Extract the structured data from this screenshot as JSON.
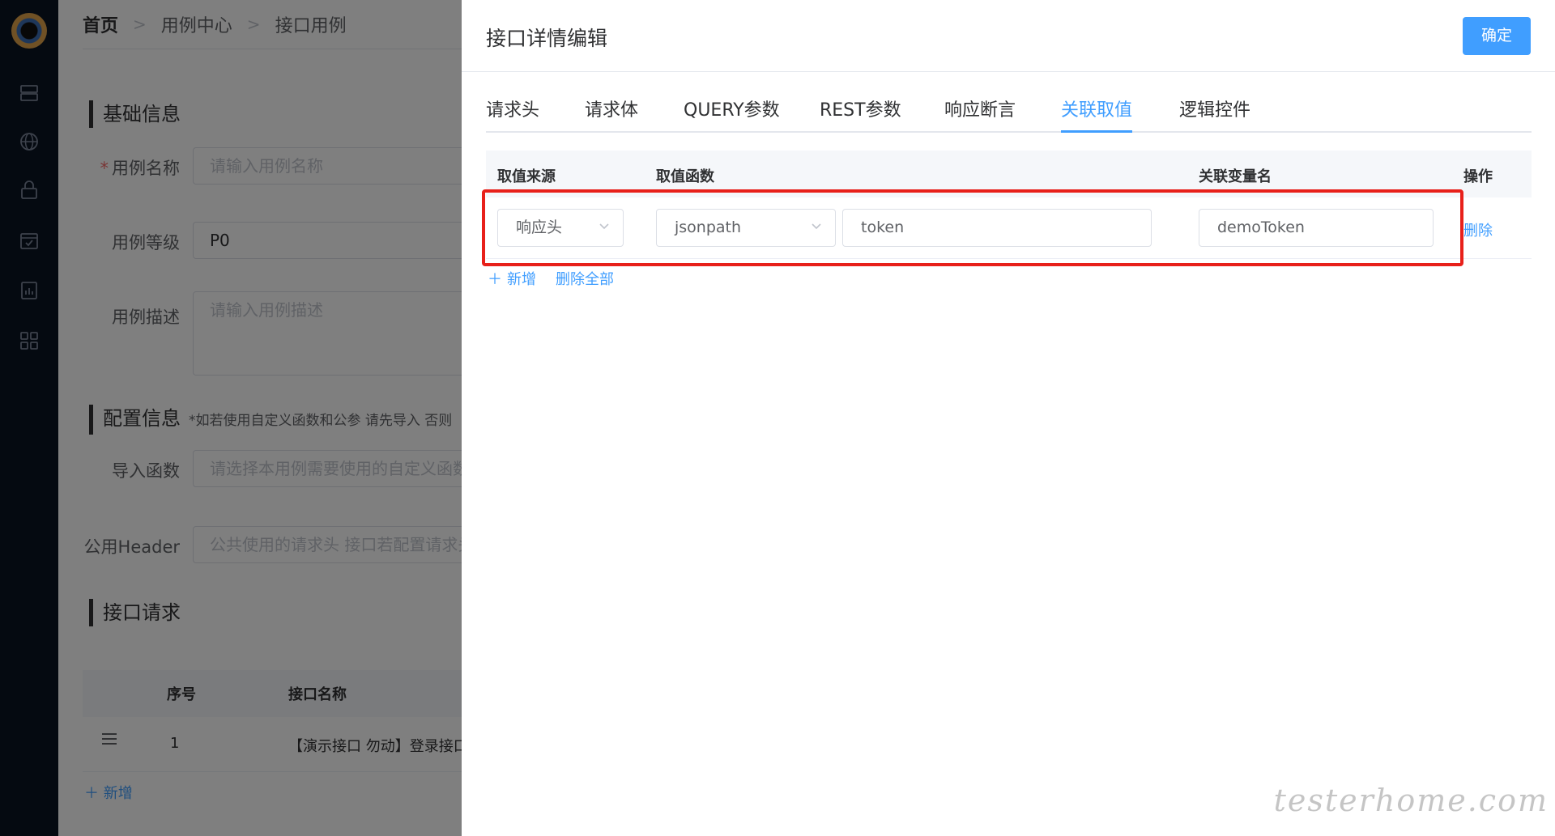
{
  "breadcrumb": {
    "home": "首页",
    "level2": "用例中心",
    "level3": "接口用例"
  },
  "form": {
    "section_basic": "基础信息",
    "case_name_label": "用例名称",
    "case_name_placeholder": "请输入用例名称",
    "case_level_label": "用例等级",
    "case_level_value": "P0",
    "case_desc_label": "用例描述",
    "case_desc_placeholder": "请输入用例描述",
    "section_config": "配置信息",
    "config_note": "*如若使用自定义函数和公参 请先导入 否则",
    "import_func_label": "导入函数",
    "import_func_placeholder": "请选择本用例需要使用的自定义函数",
    "common_header_label": "公用Header",
    "common_header_placeholder": "公共使用的请求头 接口若配置请求头",
    "section_api": "接口请求"
  },
  "api_table": {
    "headers": [
      "序号",
      "接口名称"
    ],
    "rows": [
      {
        "index": "1",
        "name": "【演示接口 勿动】登录接口"
      }
    ],
    "add_label": "新增"
  },
  "drawer": {
    "title": "接口详情编辑",
    "confirm_label": "确定",
    "tabs": [
      "请求头",
      "请求体",
      "QUERY参数",
      "REST参数",
      "响应断言",
      "关联取值",
      "逻辑控件"
    ],
    "active_tab": "关联取值",
    "table": {
      "headers": {
        "source": "取值来源",
        "func": "取值函数",
        "var": "关联变量名",
        "op": "操作"
      },
      "rows": [
        {
          "source": "响应头",
          "func": "jsonpath",
          "expr": "token",
          "var": "demoToken",
          "delete": "删除"
        }
      ]
    },
    "add_label": "新增",
    "delete_all_label": "删除全部"
  },
  "watermark": "testerhome.com",
  "colors": {
    "primary": "#409eff",
    "highlight_box": "#e8201a",
    "nav_bg": "#0b1423"
  }
}
